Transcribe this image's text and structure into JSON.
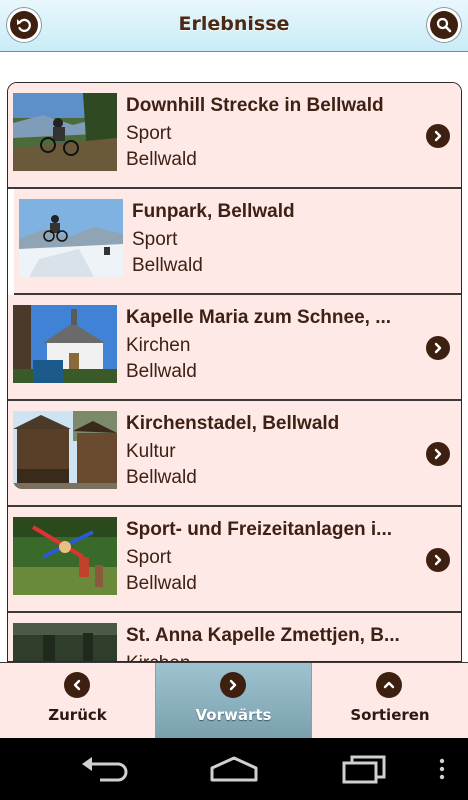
{
  "header": {
    "title": "Erlebnisse",
    "back_icon": "back-arrow-icon",
    "search_icon": "search-icon"
  },
  "items": [
    {
      "title": "Downhill Strecke in Bellwald",
      "category": "Sport",
      "place": "Bellwald",
      "thumb": "downhill-photo"
    },
    {
      "title": "Funpark, Bellwald",
      "category": "Sport",
      "place": "Bellwald",
      "thumb": "funpark-photo"
    },
    {
      "title": "Kapelle Maria zum Schnee, ...",
      "category": "Kirchen",
      "place": "Bellwald",
      "thumb": "chapel-photo"
    },
    {
      "title": "Kirchenstadel, Bellwald",
      "category": "Kultur",
      "place": "Bellwald",
      "thumb": "barn-photo"
    },
    {
      "title": "Sport- und Freizeitanlagen i...",
      "category": "Sport",
      "place": "Bellwald",
      "thumb": "playground-photo"
    },
    {
      "title": "St. Anna Kapelle Zmettjen, B...",
      "category": "Kirchen",
      "place": "",
      "thumb": "forest-photo"
    }
  ],
  "tabs": [
    {
      "label": "Zurück",
      "icon": "chevron-left-icon",
      "active": false
    },
    {
      "label": "Vorwärts",
      "icon": "chevron-right-icon",
      "active": true
    },
    {
      "label": "Sortieren",
      "icon": "chevron-up-icon",
      "active": false
    }
  ],
  "system_nav": {
    "back_icon": "android-back-icon",
    "home_icon": "android-home-icon",
    "recents_icon": "android-recents-icon",
    "menu_icon": "android-menu-icon"
  },
  "colors": {
    "header_bg": "#c9ecf7",
    "row_bg": "#ffe9e7",
    "text_brown": "#3e2114",
    "icon_brown": "#3d2010",
    "active_tab": "#7aa0ae"
  }
}
